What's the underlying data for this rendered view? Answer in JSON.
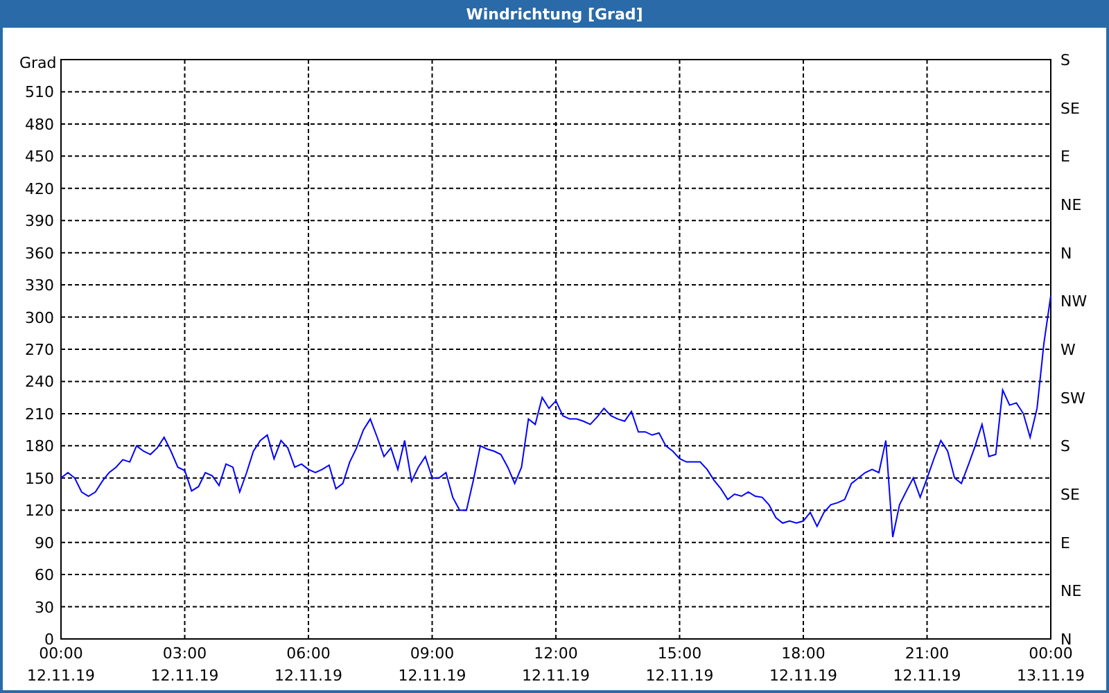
{
  "window": {
    "title": "Windrichtung [Grad]"
  },
  "chart": {
    "chart_data": {
      "type": "line",
      "ylabel": "Grad",
      "grid": true,
      "ylim": [
        0,
        540
      ],
      "yticks": [
        0,
        30,
        60,
        90,
        120,
        150,
        180,
        210,
        240,
        270,
        300,
        330,
        360,
        390,
        420,
        450,
        480,
        510
      ],
      "categories": [
        "00:00\n12.11.19",
        null,
        null,
        null,
        null,
        null,
        null,
        null,
        null,
        null,
        null,
        null,
        null,
        null,
        null,
        null,
        null,
        null,
        "03:00\n12.11.19",
        null,
        null,
        null,
        null,
        null,
        null,
        null,
        null,
        null,
        null,
        null,
        null,
        null,
        null,
        null,
        null,
        null,
        "06:00\n12.11.19",
        null,
        null,
        null,
        null,
        null,
        null,
        null,
        null,
        null,
        null,
        null,
        null,
        null,
        null,
        null,
        null,
        null,
        "09:00\n12.11.19",
        null,
        null,
        null,
        null,
        null,
        null,
        null,
        null,
        null,
        null,
        null,
        null,
        null,
        null,
        null,
        null,
        null,
        "12:00\n12.11.19",
        null,
        null,
        null,
        null,
        null,
        null,
        null,
        null,
        null,
        null,
        null,
        null,
        null,
        null,
        null,
        null,
        null,
        "15:00\n12.11.19",
        null,
        null,
        null,
        null,
        null,
        null,
        null,
        null,
        null,
        null,
        null,
        null,
        null,
        null,
        null,
        null,
        null,
        "18:00\n12.11.19",
        null,
        null,
        null,
        null,
        null,
        null,
        null,
        null,
        null,
        null,
        null,
        null,
        null,
        null,
        null,
        null,
        null,
        "21:00\n12.11.19",
        null,
        null,
        null,
        null,
        null,
        null,
        null,
        null,
        null,
        null,
        null,
        null,
        null,
        null,
        null,
        null,
        null,
        "00:00\n13.11.19"
      ],
      "series": [
        {
          "color": "#0000ff",
          "values": [
            150,
            155,
            150,
            137,
            133,
            137,
            147,
            155,
            160,
            167,
            165,
            180,
            175,
            172,
            178,
            188,
            175,
            160,
            157,
            138,
            142,
            155,
            152,
            143,
            163,
            160,
            137,
            155,
            175,
            185,
            190,
            168,
            185,
            178,
            160,
            163,
            158,
            155,
            158,
            162,
            140,
            145,
            165,
            178,
            195,
            205,
            188,
            170,
            178,
            158,
            185,
            147,
            160,
            170,
            150,
            150,
            155,
            132,
            120,
            120,
            148,
            180,
            177,
            175,
            172,
            160,
            145,
            160,
            205,
            200,
            225,
            215,
            222,
            208,
            205,
            205,
            203,
            200,
            207,
            215,
            208,
            205,
            203,
            212,
            193,
            193,
            190,
            192,
            180,
            175,
            168,
            165,
            165,
            165,
            158,
            148,
            140,
            130,
            135,
            133,
            137,
            133,
            132,
            125,
            113,
            108,
            110,
            108,
            110,
            118,
            105,
            118,
            125,
            127,
            130,
            145,
            150,
            155,
            158,
            155,
            185,
            95,
            125,
            138,
            150,
            132,
            150,
            168,
            185,
            175,
            150,
            145,
            162,
            180,
            200,
            170,
            172,
            232,
            218,
            220,
            210,
            188,
            215,
            275,
            320
          ]
        }
      ]
    },
    "compass_axis": [
      "S",
      "SE",
      "E",
      "NE",
      "N",
      "NW",
      "W",
      "SW",
      "S",
      "SE",
      "E",
      "NE",
      "N"
    ]
  }
}
